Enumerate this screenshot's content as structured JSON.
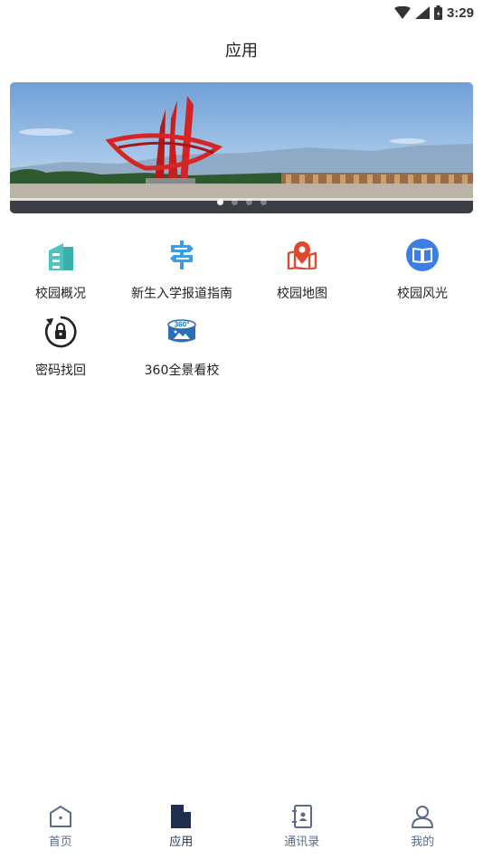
{
  "status_bar": {
    "time": "3:29",
    "icons": [
      "wifi-icon",
      "signal-icon",
      "battery-icon"
    ]
  },
  "header": {
    "title": "应用"
  },
  "banner": {
    "image": "campus-sculpture-photo",
    "slide_count": 4,
    "active_slide": 1
  },
  "apps": [
    {
      "label": "校园概况",
      "icon": "building-icon",
      "color": "#4fc3c0"
    },
    {
      "label": "新生入学报道指南",
      "icon": "signpost-icon",
      "color": "#3a9ee8"
    },
    {
      "label": "校园地图",
      "icon": "map-pin-icon",
      "color": "#e0492f"
    },
    {
      "label": "校园风光",
      "icon": "book-icon",
      "color": "#3c7de6"
    },
    {
      "label": "密码找回",
      "icon": "lock-reset-icon",
      "color": "#222222"
    },
    {
      "label": "360全景看校",
      "icon": "panorama-360-icon",
      "color": "#2a6fb6"
    }
  ],
  "bottom_nav": {
    "items": [
      {
        "label": "首页",
        "icon": "home-icon",
        "active": false
      },
      {
        "label": "应用",
        "icon": "document-icon",
        "active": true
      },
      {
        "label": "通讯录",
        "icon": "contacts-icon",
        "active": false
      },
      {
        "label": "我的",
        "icon": "user-icon",
        "active": false
      }
    ]
  },
  "colors": {
    "nav_inactive": "#5b6b8a",
    "nav_active": "#1f2d4f"
  }
}
